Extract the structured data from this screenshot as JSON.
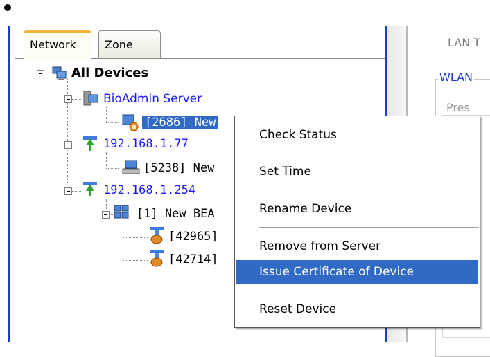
{
  "tabs": [
    {
      "label": "Network",
      "active": true
    },
    {
      "label": "Zone",
      "active": false
    }
  ],
  "tree": {
    "root": {
      "label": "All Devices",
      "icon": "computers-icon"
    },
    "nodes": [
      {
        "label": "BioAdmin Server",
        "icon": "server-icon",
        "style": "link"
      },
      {
        "label": "[2686] New",
        "icon": "device-alert-icon",
        "style": "selected"
      },
      {
        "label": "192.168.1.77",
        "icon": "network-node-icon",
        "style": "link"
      },
      {
        "label": "[5238] New",
        "icon": "terminal-icon",
        "style": "normal"
      },
      {
        "label": "192.168.1.254",
        "icon": "network-node-icon",
        "style": "link"
      },
      {
        "label": "[1] New BEA",
        "icon": "device-group-icon",
        "style": "normal"
      },
      {
        "label": "[42965]",
        "icon": "device-node-icon",
        "style": "normal"
      },
      {
        "label": "[42714]",
        "icon": "device-node-icon",
        "style": "normal"
      }
    ]
  },
  "right_pane": {
    "lan_label": "LAN T",
    "wlan_label": "WLAN",
    "pres_label": "Pres"
  },
  "context_menu": {
    "items": [
      {
        "label": "Check Status",
        "highlighted": false
      },
      {
        "label": "Set Time",
        "highlighted": false
      },
      {
        "label": "Rename Device",
        "highlighted": false
      },
      {
        "label": "Remove from Server",
        "highlighted": false
      },
      {
        "label": "Issue Certificate of Device",
        "highlighted": true
      },
      {
        "label": "Reset Device",
        "highlighted": false
      }
    ]
  },
  "colors": {
    "accent": "#316ac5",
    "link": "#1a1aff",
    "pane_border": "#1a3fd0",
    "active_tab_top": "#f4b43a"
  }
}
